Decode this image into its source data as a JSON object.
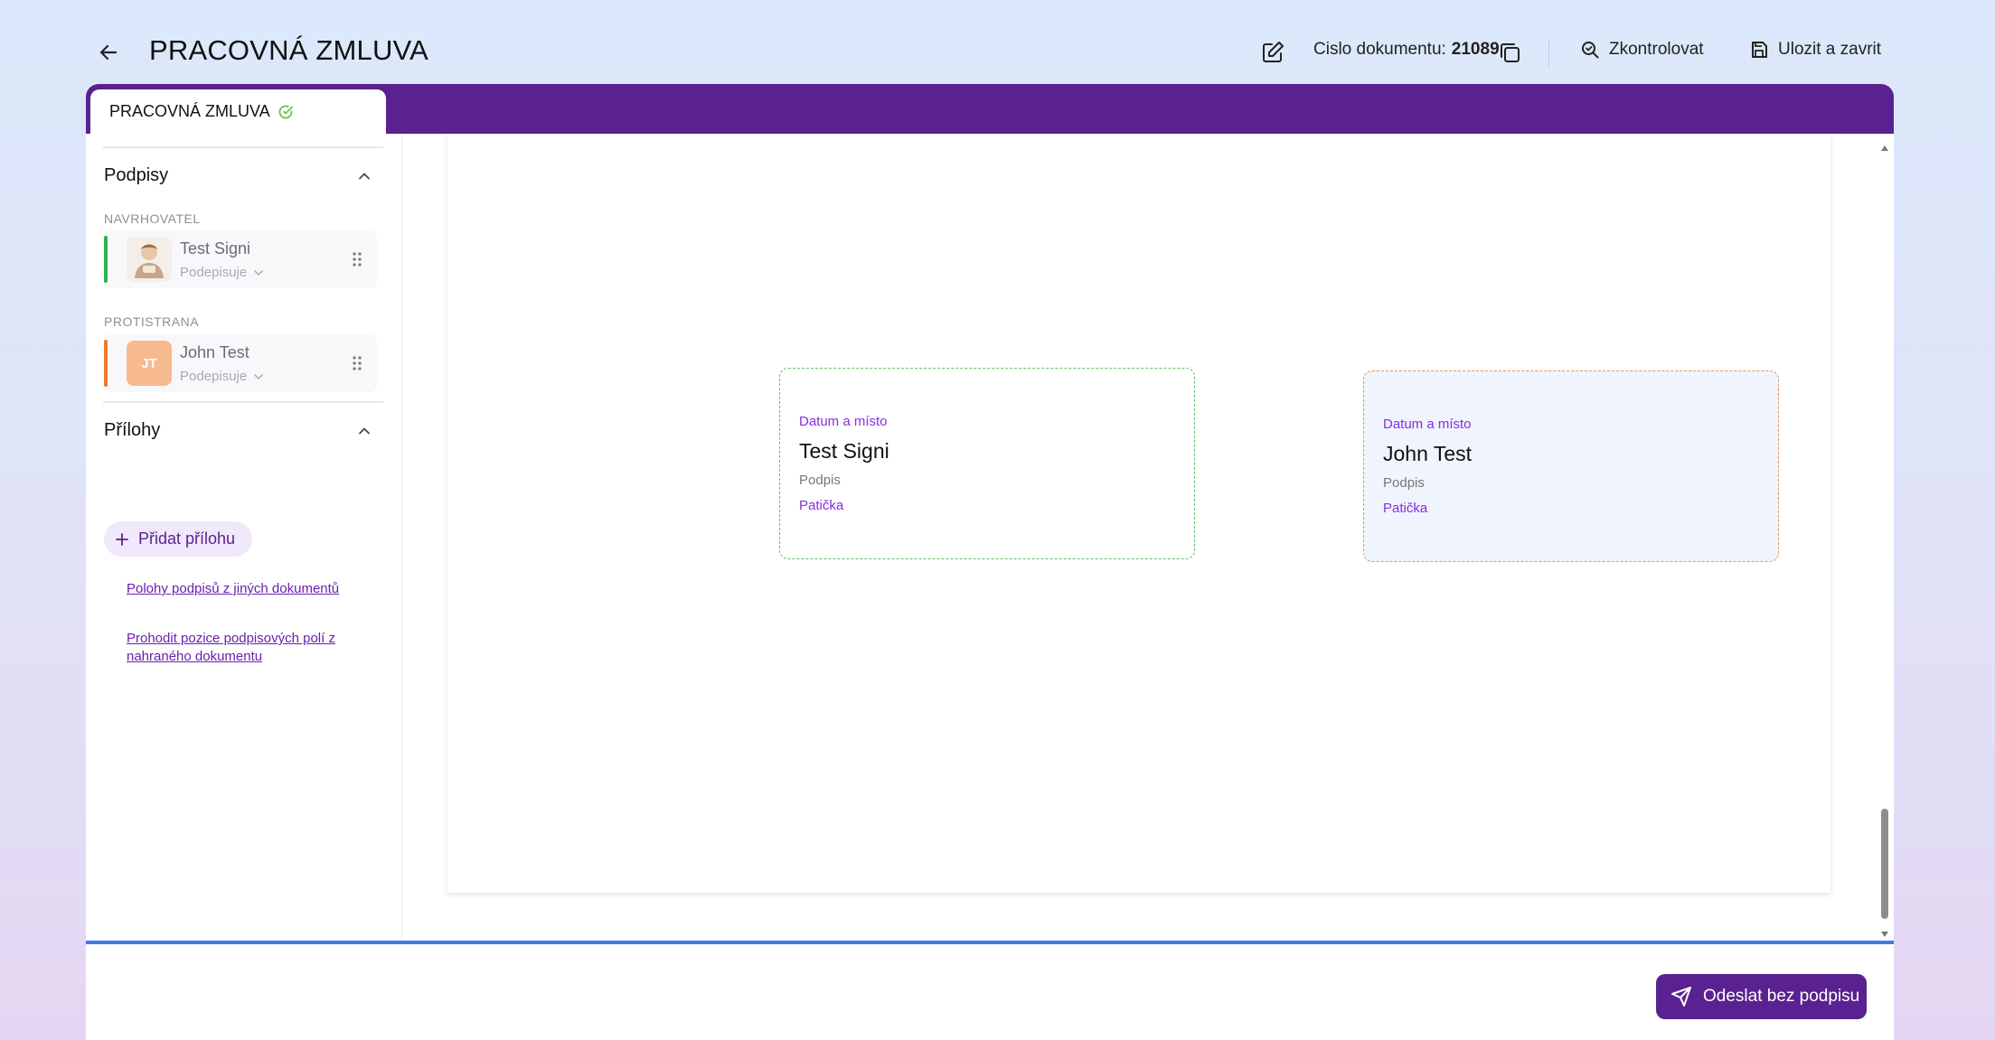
{
  "header": {
    "title": "PRACOVNÁ ZMLUVA",
    "doc_number_label": "Cislo dokumentu:",
    "doc_number_value": "21089",
    "check_label": "Zkontrolovat",
    "save_label": "Ulozit a zavrit"
  },
  "tabs": [
    {
      "label": "PRACOVNÁ ZMLUVA",
      "status": "valid"
    }
  ],
  "sidebar": {
    "signatures_title": "Podpisy",
    "proposer_label": "NAVRHOVATEL",
    "counterparty_label": "PROTISTRANA",
    "signers": [
      {
        "name": "Test Signi",
        "status": "Podepisuje",
        "color": "#2db34a"
      },
      {
        "name": "John Test",
        "initials": "JT",
        "status": "Podepisuje",
        "color": "#f07a30"
      }
    ],
    "attachments_title": "Přílohy",
    "add_attachment_label": "Přidat přílohu",
    "links": [
      "Polohy podpisů z jiných dokumentů",
      "Prohodit pozice podpisových polí z nahraného dokumentu"
    ]
  },
  "document": {
    "signature_boxes": [
      {
        "date_label": "Datum a místo",
        "name": "Test Signi",
        "sign_label": "Podpis",
        "footer_label": "Patička",
        "border_color": "#5cc06e"
      },
      {
        "date_label": "Datum a místo",
        "name": "John Test",
        "sign_label": "Podpis",
        "footer_label": "Patička",
        "border_color": "#f0905c"
      }
    ]
  },
  "footer": {
    "send_label": "Odeslat bez podpisu"
  },
  "colors": {
    "brand": "#5a2290",
    "accent_link": "#6a1fb0",
    "footer_line": "#3d7be8"
  }
}
